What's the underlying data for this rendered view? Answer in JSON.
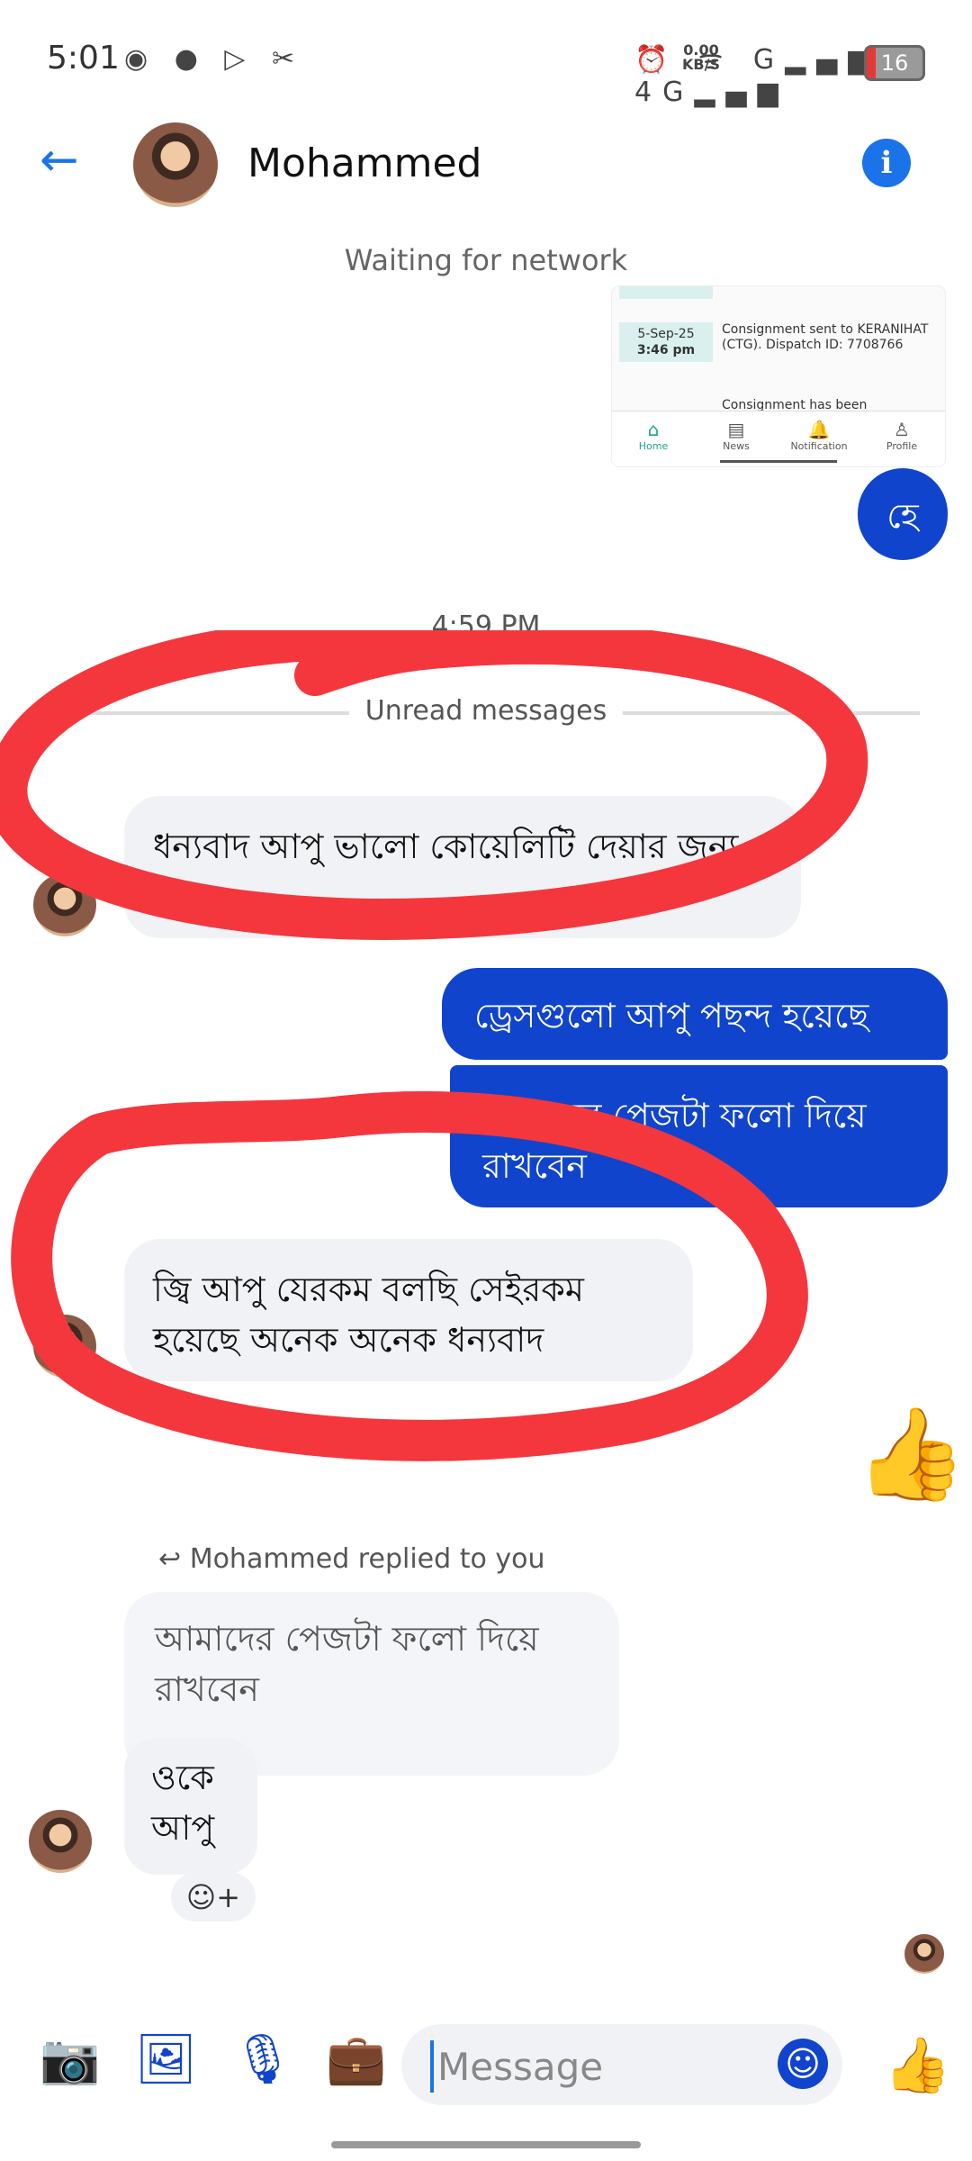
{
  "status_bar": {
    "time": "5:01",
    "left_icons": "◉ ● ▷ ✂",
    "speed_value": "0.00",
    "speed_unit": "KB/S",
    "right_icons": "⏰   ᯤ G▂▄▆ 4G▂▄▆",
    "battery": "16"
  },
  "header": {
    "back_icon": "←",
    "title": "Mohammed",
    "info_icon": "i"
  },
  "network_status": "Waiting for network",
  "shared_image": {
    "date": "5-Sep-25",
    "time": "3:46 pm",
    "message": "Consignment sent to KERANIHAT (CTG). Dispatch ID: 7708766",
    "message2": "Consignment has been",
    "nav": [
      {
        "label": "Home",
        "icon": "⌂"
      },
      {
        "label": "News",
        "icon": "▤"
      },
      {
        "label": "Notification",
        "icon": "🔔"
      },
      {
        "label": "Profile",
        "icon": "♙"
      }
    ]
  },
  "messages": {
    "out_he": "হে",
    "timestamp": "4:59 PM",
    "unread": "Unread messages",
    "in_1": "ধন্যবাদ আপু ভালো কোয়েলিটি দেয়ার জন্য",
    "out_1": "ড্রেসগুলো আপু পছন্দ হয়েছে",
    "out_2": "আমাদের পেজটা ফলো দিয়ে রাখবেন",
    "in_2": "জ্বি আপু যেরকম বলছি সেইরকম হয়েছে অনেক অনেক ধন্যবাদ",
    "like_icon": "👍",
    "reply_label": "Mohammed replied to you",
    "reply_icon": "↩",
    "reply_quote": "আমাদের পেজটা ফলো দিয়ে রাখবেন",
    "in_3": "ওকে আপু",
    "react_icon": "☺+"
  },
  "composer": {
    "camera_icon": "📷",
    "gallery_icon": "🖼",
    "mic_icon": "🎙",
    "briefcase_icon": "💼",
    "placeholder": "Message",
    "emoji_icon": "☺",
    "like_icon": "👍"
  },
  "colors": {
    "accent": "#1144cc",
    "link_blue": "#1a73e8",
    "annotation_red": "#f4373d"
  }
}
